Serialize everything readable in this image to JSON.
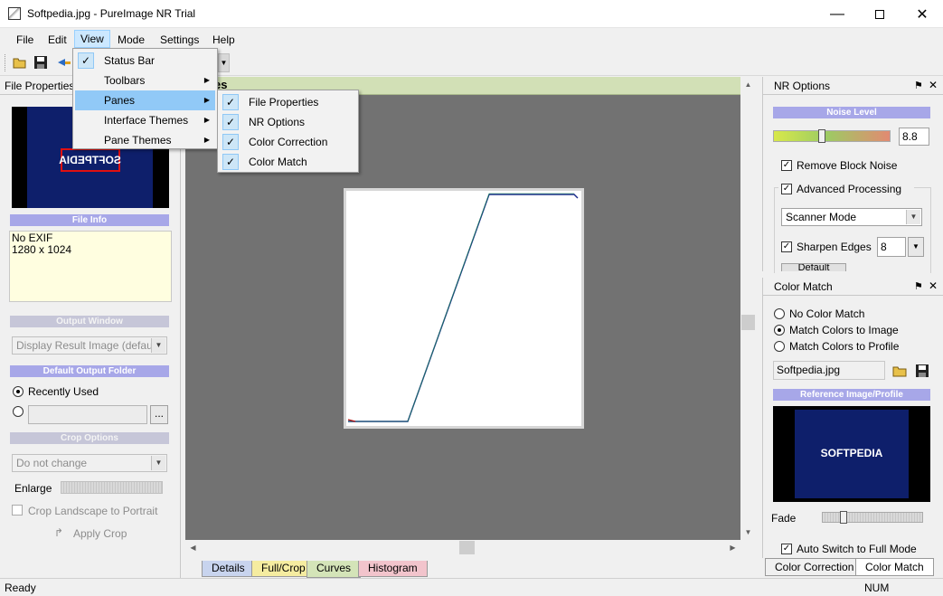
{
  "window": {
    "title": "Softpedia.jpg - PureImage NR Trial"
  },
  "menubar": {
    "items": [
      "File",
      "Edit",
      "View",
      "Mode",
      "Settings",
      "Help"
    ]
  },
  "view_menu": {
    "items": [
      {
        "label": "Status Bar",
        "checked": true,
        "submenu": false
      },
      {
        "label": "Toolbars",
        "checked": false,
        "submenu": true
      },
      {
        "label": "Panes",
        "checked": false,
        "submenu": true
      },
      {
        "label": "Interface Themes",
        "checked": false,
        "submenu": true
      },
      {
        "label": "Pane Themes",
        "checked": false,
        "submenu": true
      }
    ]
  },
  "panes_menu": {
    "items": [
      {
        "label": "File Properties",
        "checked": true
      },
      {
        "label": "NR Options",
        "checked": true
      },
      {
        "label": "Color Correction",
        "checked": true
      },
      {
        "label": "Color Match",
        "checked": true
      }
    ]
  },
  "file_properties": {
    "header": "File Properties",
    "thumbnail_text": "SOFTPEDIA",
    "file_info_title": "File Info",
    "file_info_lines": [
      "No EXIF",
      "1280 x 1024"
    ],
    "output_window_title": "Output Window",
    "output_window_value": "Display Result Image (default)",
    "default_output_folder_title": "Default Output Folder",
    "recently_used": "Recently Used",
    "browse_label": "...",
    "crop_options_title": "Crop Options",
    "crop_value": "Do not change",
    "enlarge": "Enlarge",
    "crop_landscape": "Crop Landscape to Portrait",
    "apply_crop": "Apply Crop"
  },
  "center": {
    "header_fragment": "es",
    "tabs": [
      "Details",
      "Full/Crop",
      "Curves",
      "Histogram"
    ],
    "active_tab": "Curves"
  },
  "nr_options": {
    "header": "NR Options",
    "noise_level_title": "Noise Level",
    "noise_level_value": "8.8",
    "noise_level_fraction": 0.4,
    "remove_block_noise": "Remove Block Noise",
    "advanced_processing": "Advanced Processing",
    "mode_value": "Scanner Mode",
    "sharpen_edges": "Sharpen Edges",
    "sharpen_value": "8",
    "default_btn": "Default"
  },
  "color_match": {
    "header": "Color Match",
    "options": [
      "No Color Match",
      "Match Colors to Image",
      "Match Colors to Profile"
    ],
    "selected": 1,
    "file": "Softpedia.jpg",
    "reference_title": "Reference Image/Profile",
    "reference_text": "SOFTPEDIA",
    "fade": "Fade",
    "fade_fraction": 0.18,
    "auto_switch": "Auto Switch to  Full Mode"
  },
  "right_tabs": [
    "Color Correction",
    "Color Match"
  ],
  "status": {
    "left": "Ready",
    "right": "NUM"
  }
}
